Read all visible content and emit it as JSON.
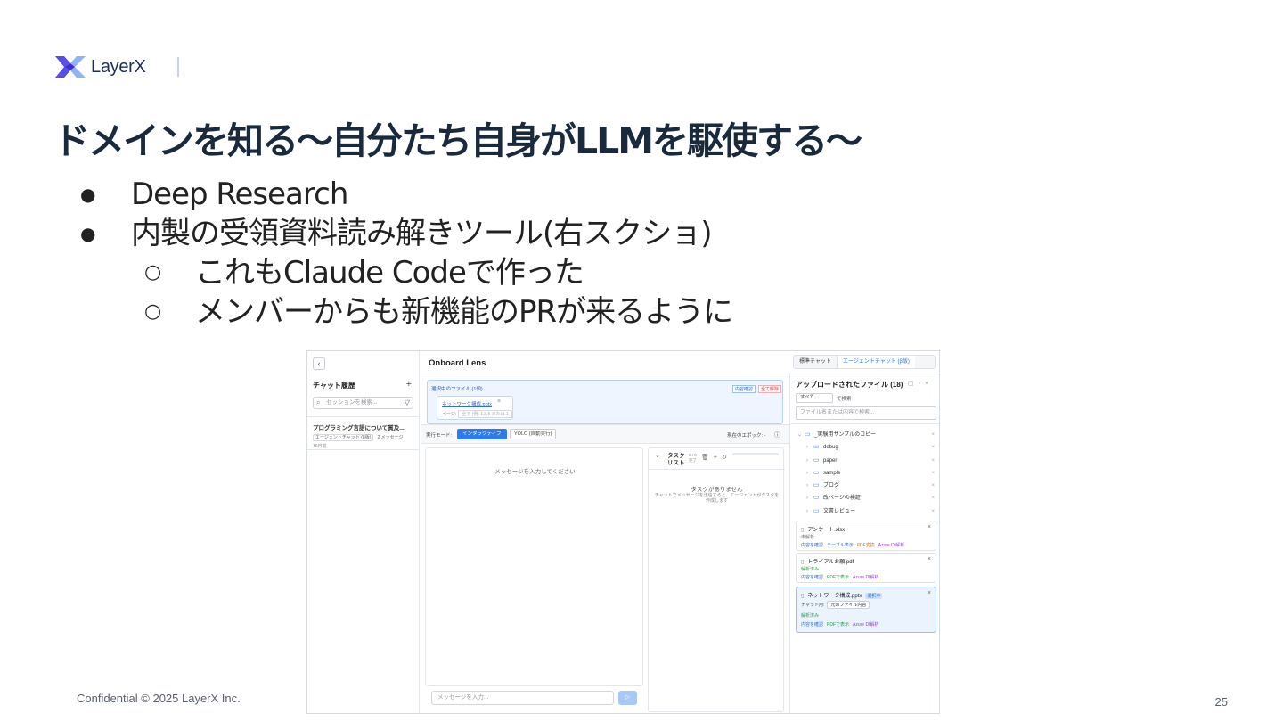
{
  "slide": {
    "logo_text": "LayerX",
    "title": "ドメインを知る〜自分たち自身がLLMを駆使する〜",
    "bullets": [
      "Deep Research",
      "内製の受領資料読み解きツール(右スクショ)"
    ],
    "sub_bullets": [
      "これもClaude Codeで作った",
      "メンバーからも新機能のPRが来るように"
    ],
    "footer": "Confidential © 2025 LayerX Inc.",
    "page_number": "25",
    "colors": {
      "accent": "#5b4ee8",
      "title": "#1a2a3c"
    }
  },
  "app": {
    "title": "Onboard Lens",
    "tabs": [
      "標準チャット",
      "エージェントチャット (β版)"
    ],
    "sidebar": {
      "back_icon": "chevron-left-icon",
      "heading": "チャット履歴",
      "add": "+",
      "search_placeholder": "セッションを検索...",
      "session": {
        "title": "プログラミング言語について質及...",
        "tag": "エージェントチャット (β版)",
        "count": "2 メッセージ",
        "date": "16日前"
      }
    },
    "selected_files": {
      "title": "選択中のファイル (1個)",
      "confirm_label": "内容確認",
      "clear_label": "全て解除",
      "file_name": "ネットワーク構成.pptx",
      "pages_label": "ページ:",
      "pages_value": "全て (例: 1,3,5 または 1"
    },
    "mode": {
      "label": "実行モード:",
      "interactive": "インタラクティブ",
      "yolo": "YOLO (自動実行)",
      "epoch": "現在のエポック: -"
    },
    "chat": {
      "hint": "メッセージを入力してください",
      "input_placeholder": "メッセージを入力...",
      "send_icon": "send-icon"
    },
    "task": {
      "title": "タスク リスト",
      "done": "0 / 0 完了",
      "empty": "タスクがありません",
      "sub": "チャットでメッセージを送信すると、エージェントがタスクを作成します"
    },
    "uploaded": {
      "title": "アップロードされたファイル (18)",
      "filter_value": "すべて",
      "filter_label": "で検索",
      "search_placeholder": "ファイル名または内容で検索...",
      "tree": [
        {
          "name": "_実験用サンプルのコピー",
          "level": 0
        },
        {
          "name": "debug",
          "level": 1
        },
        {
          "name": "paper",
          "level": 1
        },
        {
          "name": "sample",
          "level": 1
        },
        {
          "name": "ブログ",
          "level": 1
        },
        {
          "name": "改ページの検証",
          "level": 1
        },
        {
          "name": "文書レビュー",
          "level": 1
        }
      ],
      "files": [
        {
          "name": "アンケート.xlsx",
          "status": "未解析",
          "actions": [
            "内容を確認",
            "テーブル表示",
            "PDF変換",
            "Azure DI解析"
          ]
        },
        {
          "name": "トライアルお願.pdf",
          "status": "解析済み",
          "actions": [
            "内容を確認",
            "PDFで表示",
            "Azure DI解析"
          ]
        },
        {
          "name": "ネットワーク構成.pptx",
          "badge": "選択中",
          "chat_label": "チャット用:",
          "chat_value": "元のファイル内容",
          "status": "解析済み",
          "actions": [
            "内容を確認",
            "PDFで表示",
            "Azure DI解析"
          ]
        }
      ]
    }
  }
}
